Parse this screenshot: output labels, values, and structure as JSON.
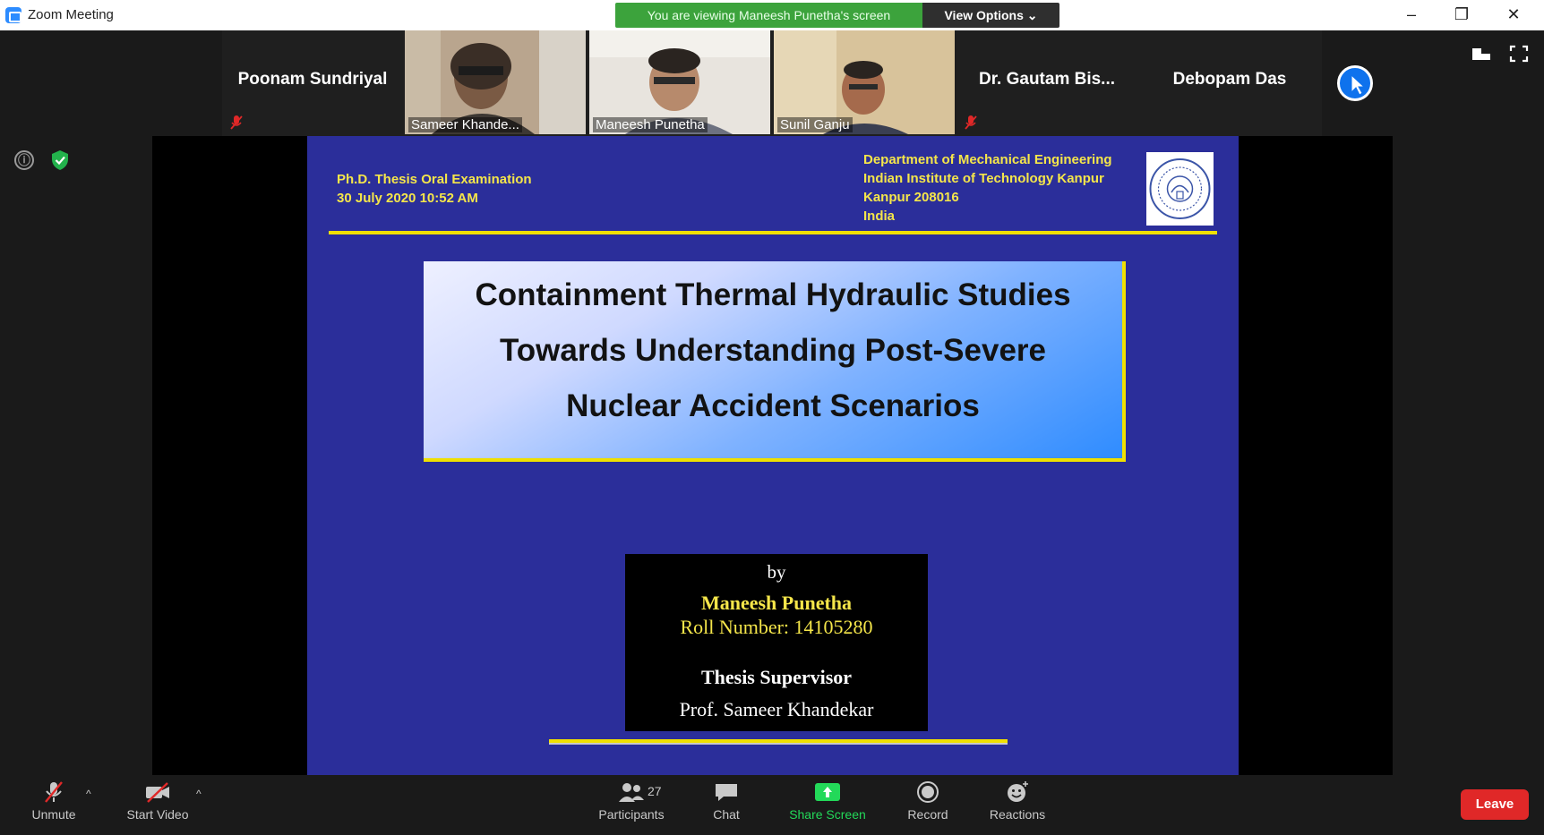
{
  "window": {
    "app_title": "Zoom Meeting",
    "viewing_banner": "You are viewing Maneesh Punetha's screen",
    "view_options_label": "View Options ⌄",
    "minimize_glyph": "–",
    "restore_glyph": "❐",
    "close_glyph": "✕"
  },
  "gallery": {
    "participants": [
      {
        "name": "Poonam Sundriyal",
        "video": false,
        "muted": true
      },
      {
        "name": "Sameer Khande...",
        "video": true
      },
      {
        "name": "Maneesh Punetha",
        "video": true
      },
      {
        "name": "Sunil Ganju",
        "video": true
      },
      {
        "name": "Dr. Gautam Bis...",
        "video": false,
        "muted": true
      },
      {
        "name": "Debopam Das",
        "video": false
      }
    ]
  },
  "left_icons": {
    "info": "ⓘ"
  },
  "slide": {
    "header_left": [
      "Ph.D. Thesis Oral Examination",
      "30 July 2020  10:52 AM"
    ],
    "header_right": [
      "Department of Mechanical Engineering",
      "Indian Institute of Technology Kanpur",
      "Kanpur 208016",
      "India"
    ],
    "title_lines": [
      "Containment Thermal Hydraulic Studies",
      "Towards Understanding Post-Severe",
      "Nuclear Accident Scenarios"
    ],
    "by": "by",
    "author": "Maneesh Punetha",
    "roll": "Roll Number: 14105280",
    "supervisor_heading": "Thesis Supervisor",
    "supervisor": "Prof. Sameer Khandekar"
  },
  "toolbar": {
    "unmute": "Unmute",
    "start_video": "Start Video",
    "participants": "Participants",
    "participants_count": "27",
    "chat": "Chat",
    "share_screen": "Share Screen",
    "record": "Record",
    "reactions": "Reactions",
    "leave": "Leave",
    "caret": "^"
  },
  "colors": {
    "zoom_blue": "#2d8cff",
    "banner_green": "#3ca33c",
    "share_green": "#23d959",
    "leave_red": "#e02828",
    "slide_blue": "#2b2e9a",
    "slide_yellow": "#f5e64a"
  }
}
